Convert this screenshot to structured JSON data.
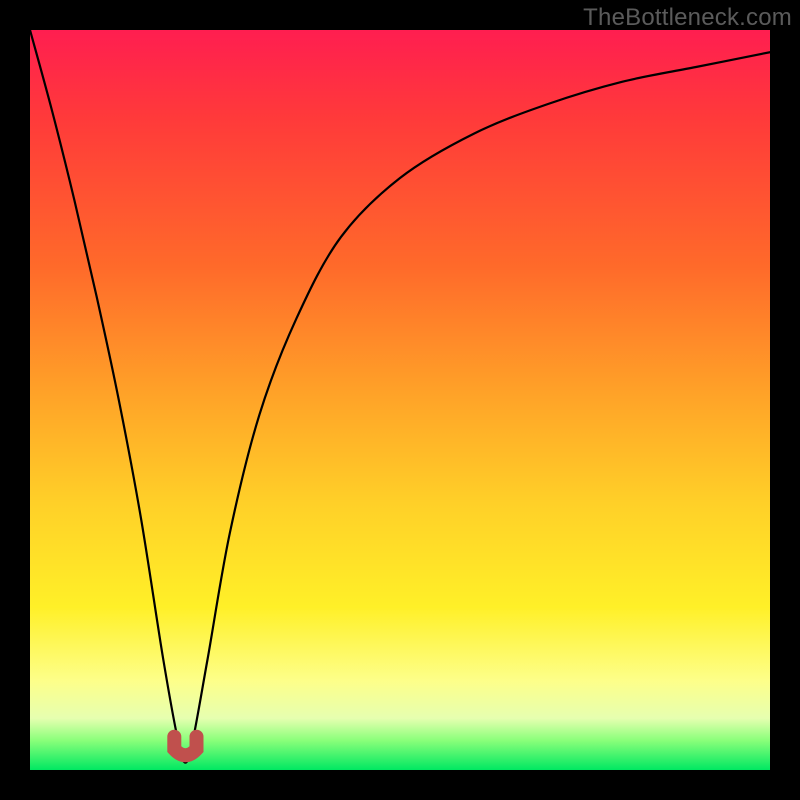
{
  "watermark": "TheBottleneck.com",
  "colors": {
    "frame_bg": "#000000",
    "gradient_top": "#ff1e50",
    "gradient_mid_orange": "#ffa528",
    "gradient_mid_yellow": "#fff028",
    "gradient_bottom": "#00e862",
    "curve_stroke": "#000000",
    "marker_stroke": "#c0504d"
  },
  "chart_data": {
    "type": "line",
    "title": "",
    "xlabel": "",
    "ylabel": "",
    "xlim": [
      0,
      100
    ],
    "ylim": [
      0,
      100
    ],
    "grid": false,
    "legend": false,
    "comment": "y is bottleneck percentage (100=top/red, 0=bottom/green). Minimum near x≈21 with y≈1.",
    "x": [
      0,
      3,
      6,
      9,
      12,
      15,
      18,
      20,
      21,
      22,
      24,
      27,
      31,
      36,
      42,
      50,
      60,
      70,
      80,
      90,
      100
    ],
    "y": [
      100,
      89,
      77,
      64,
      50,
      34,
      15,
      4,
      1,
      4,
      15,
      32,
      48,
      61,
      72,
      80,
      86,
      90,
      93,
      95,
      97
    ],
    "marker": {
      "x_range": [
        19.5,
        22.5
      ],
      "y": 2,
      "shape": "u"
    }
  }
}
